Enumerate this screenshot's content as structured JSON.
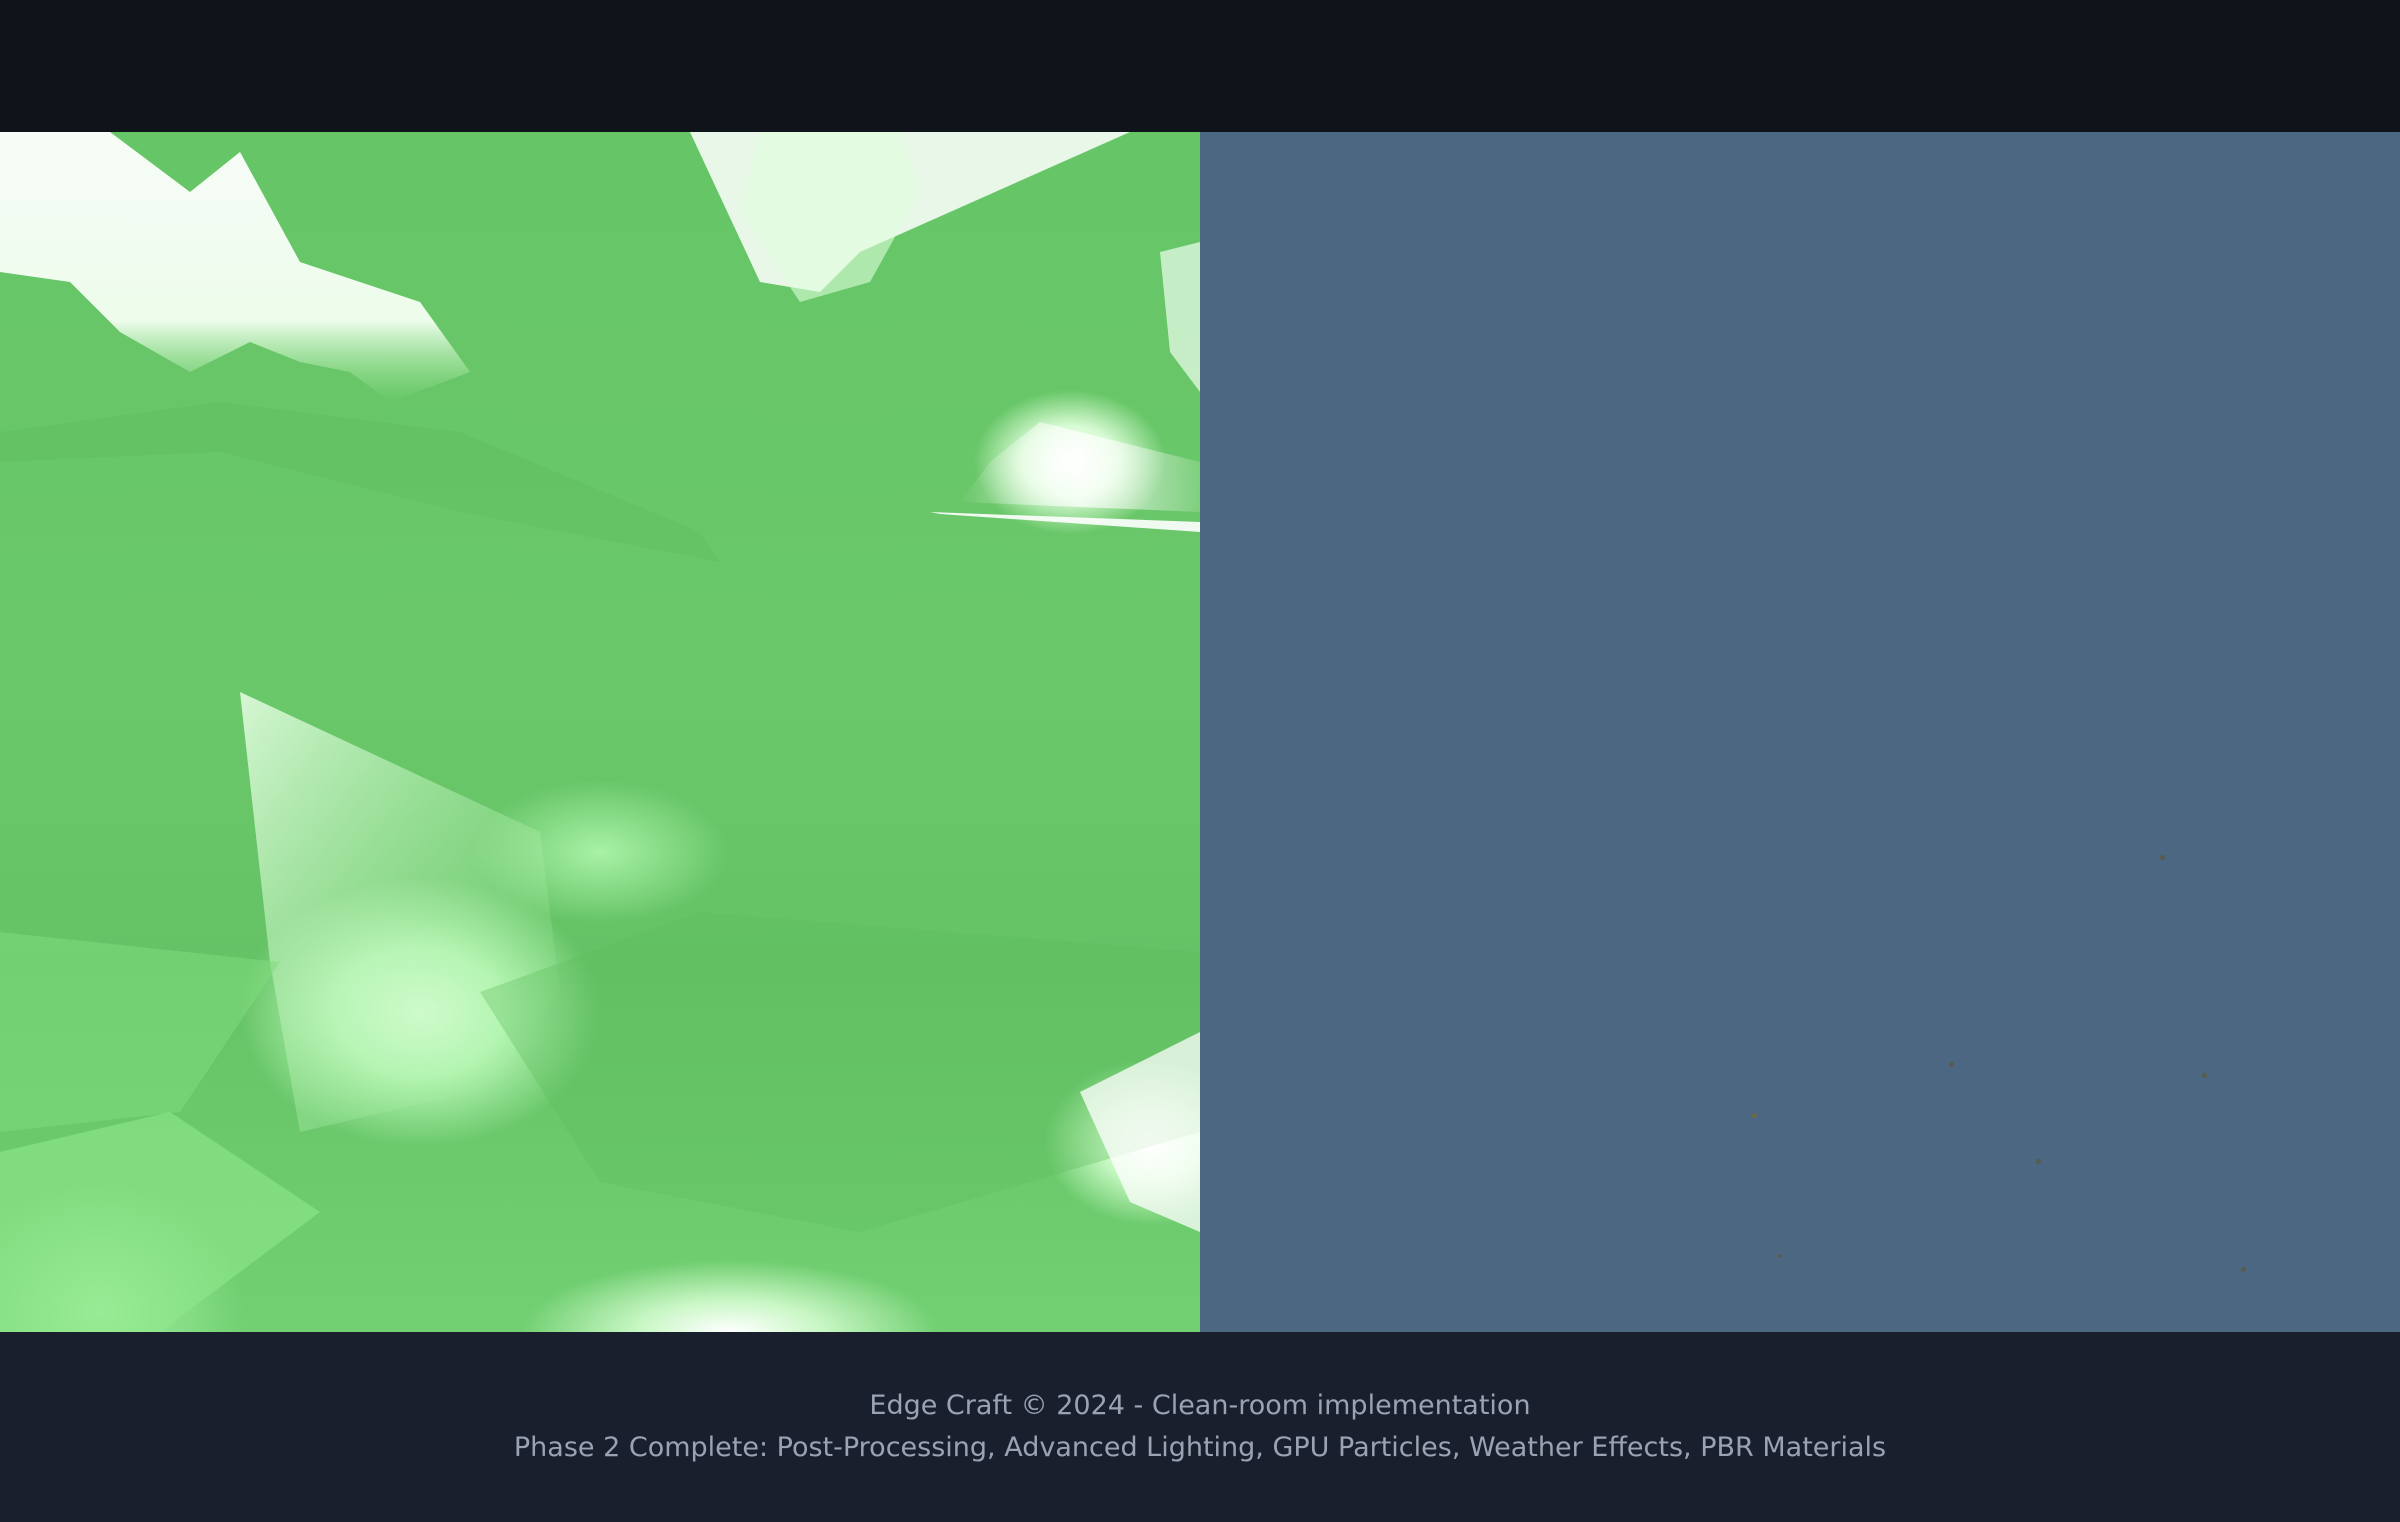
{
  "footer": {
    "copyright": "Edge Craft © 2024 - Clean-room implementation",
    "status": "Phase 2 Complete: Post-Processing, Advanced Lighting, GPU Particles, Weather Effects, PBR Materials"
  },
  "colors": {
    "top_bar": "#0f141a",
    "terrain_green": "#66c566",
    "scene_background": "#4b6782",
    "footer_background": "#1a1f2d",
    "footer_text": "#9aa3b2"
  }
}
